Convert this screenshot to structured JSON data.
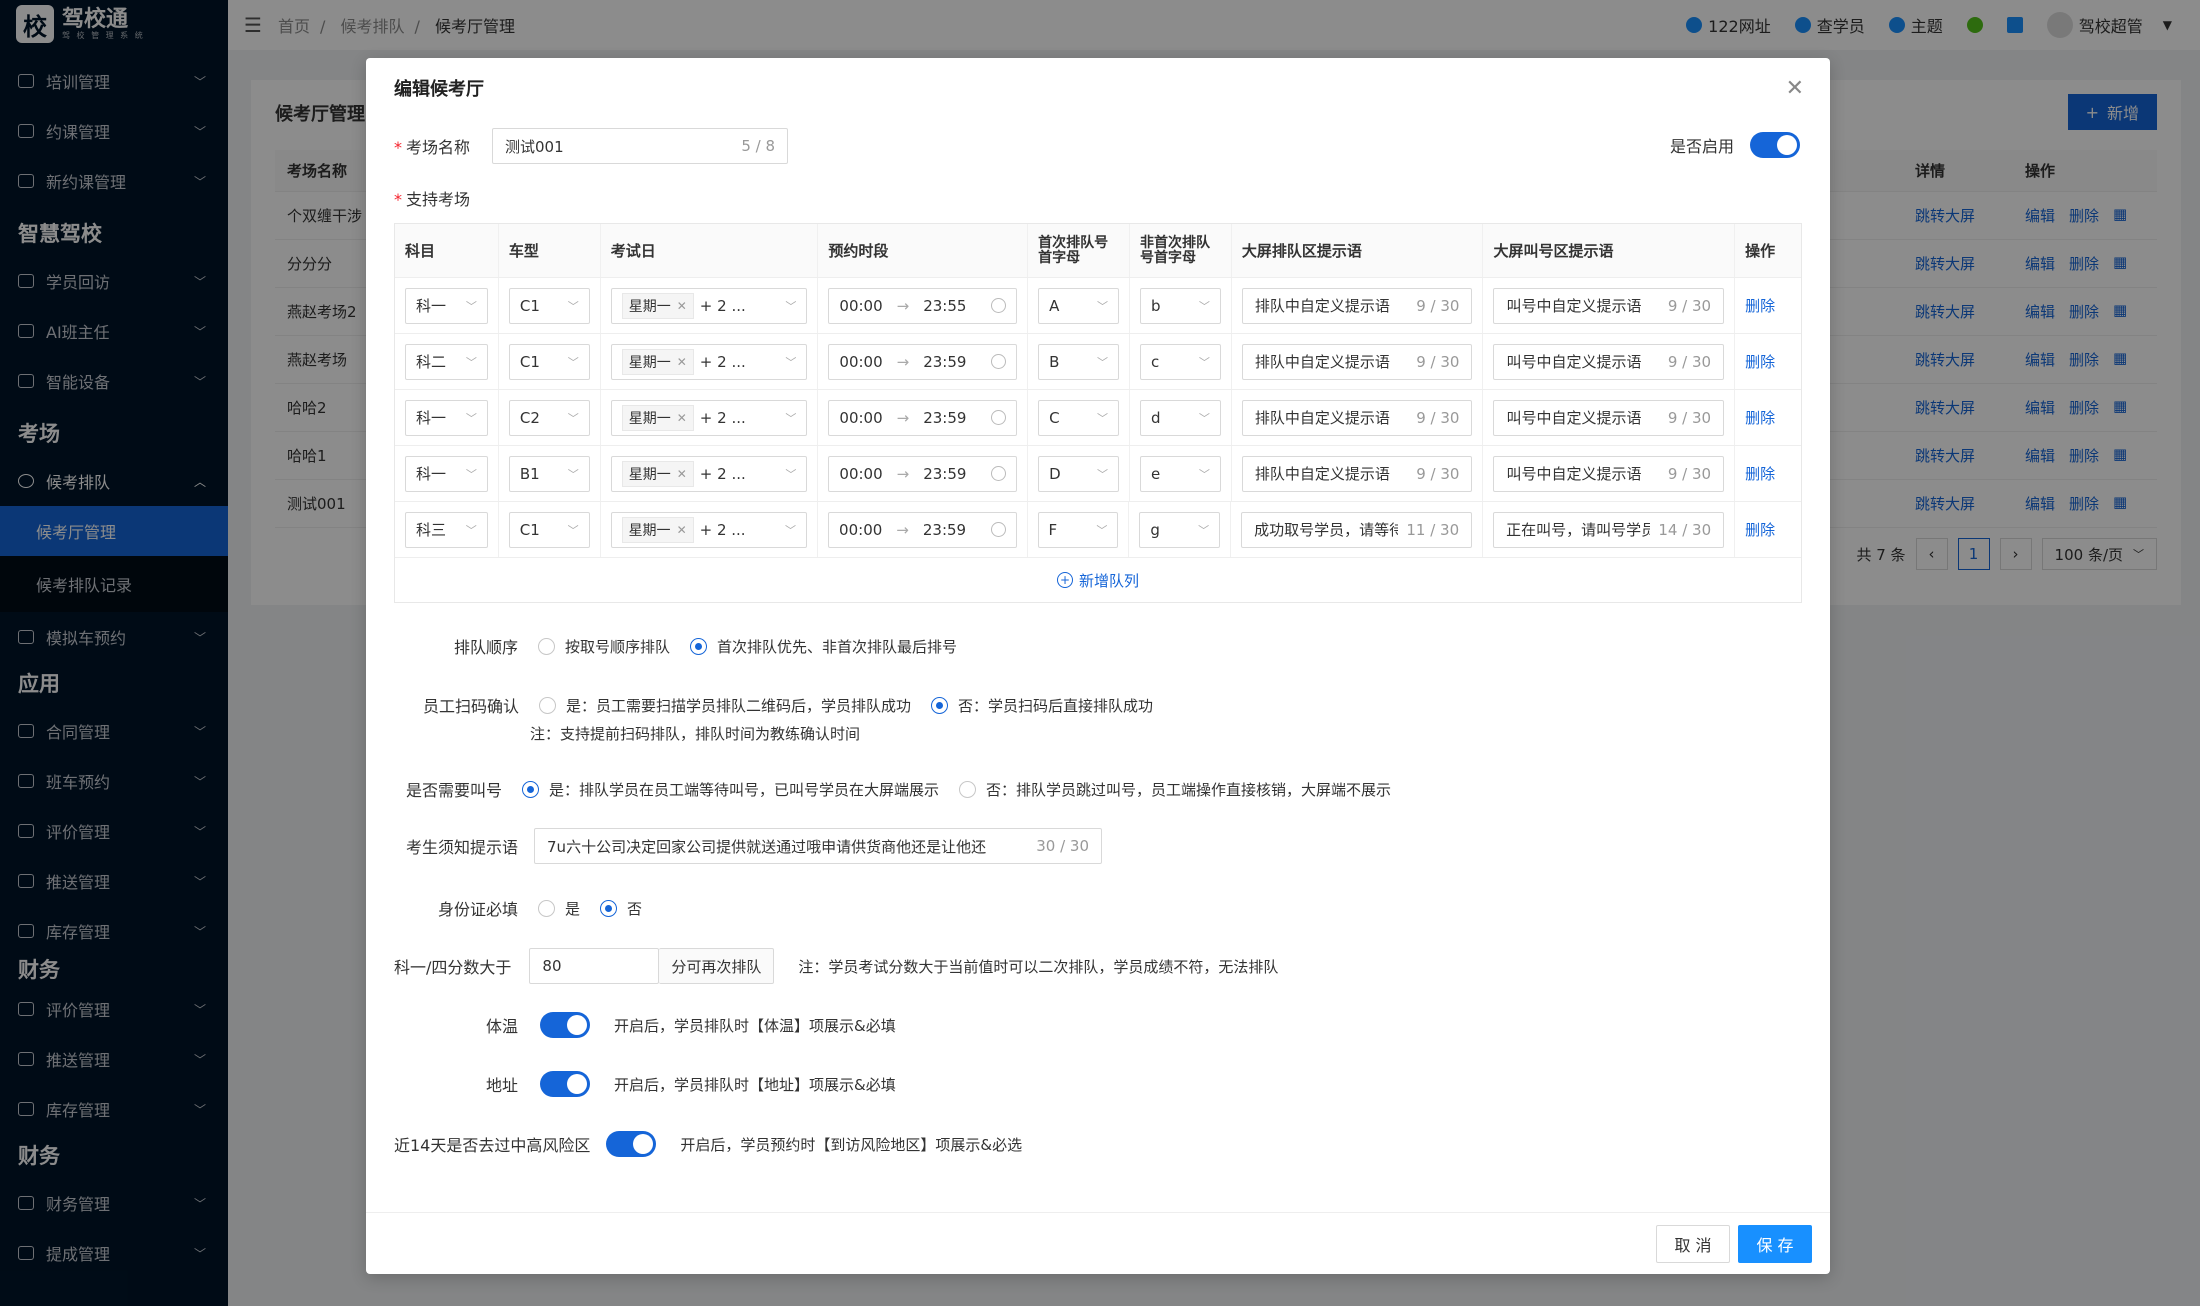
{
  "sidebar": {
    "logo_text": "驾校通",
    "logo_sub": "驾 校 管 理 系 统",
    "logo_mark": "校",
    "items_top": [
      {
        "label": "培训管理"
      },
      {
        "label": "约课管理"
      },
      {
        "label": "新约课管理"
      }
    ],
    "group_smart": "智慧驾校",
    "items_smart": [
      {
        "label": "学员回访"
      },
      {
        "label": "AI班主任"
      },
      {
        "label": "智能设备"
      }
    ],
    "group_exam": "考场",
    "exam_parent": "候考排队",
    "exam_sub": [
      {
        "label": "候考厅管理"
      },
      {
        "label": "候考排队记录"
      }
    ],
    "item_sim": "模拟车预约",
    "group_app": "应用",
    "items_app": [
      {
        "label": "合同管理"
      },
      {
        "label": "班车预约"
      },
      {
        "label": "评价管理"
      },
      {
        "label": "推送管理"
      },
      {
        "label": "库存管理"
      }
    ],
    "group_finance_partial": "财务",
    "items_app2": [
      {
        "label": "评价管理"
      },
      {
        "label": "推送管理"
      },
      {
        "label": "库存管理"
      }
    ],
    "group_finance": "财务",
    "items_finance": [
      {
        "label": "财务管理"
      },
      {
        "label": "提成管理"
      }
    ]
  },
  "header": {
    "breadcrumb": [
      "首页",
      "候考排队",
      "候考厅管理"
    ],
    "links": [
      {
        "label": "122网址"
      },
      {
        "label": "查学员"
      },
      {
        "label": "主题"
      }
    ],
    "user": "驾校超管"
  },
  "background": {
    "title": "候考厅管理",
    "add_label": "新增",
    "columns": {
      "name": "考场名称",
      "detail": "详情",
      "ops": "操作"
    },
    "rows": [
      {
        "name": "个双缠干涉"
      },
      {
        "name": "分分分"
      },
      {
        "name": "燕赵考场2"
      },
      {
        "name": "燕赵考场"
      },
      {
        "name": "哈哈2"
      },
      {
        "name": "哈哈1"
      },
      {
        "name": "测试001"
      }
    ],
    "detail_link": "跳转大屏",
    "op_edit": "编辑",
    "op_delete": "删除",
    "total": "共 7 条",
    "page": "1",
    "page_size": "100 条/页"
  },
  "modal": {
    "title": "编辑候考厅",
    "name_label": "考场名称",
    "name_value": "测试001",
    "name_count": "5 / 8",
    "enable_label": "是否启用",
    "support_label": "支持考场",
    "table_headers": [
      "科目",
      "车型",
      "考试日",
      "预约时段",
      "首次排队号首字母",
      "非首次排队号首字母",
      "大屏排队区提示语",
      "大屏叫号区提示语",
      "操作"
    ],
    "rows": [
      {
        "subject": "科一",
        "car": "C1",
        "day": "星期一",
        "more": "+ 2 ...",
        "start": "00:00",
        "end": "23:55",
        "first": "A",
        "nonfirst": "b",
        "queue_tip": "排队中自定义提示语",
        "queue_cnt": "9 / 30",
        "call_tip": "叫号中自定义提示语",
        "call_cnt": "9 / 30"
      },
      {
        "subject": "科二",
        "car": "C1",
        "day": "星期一",
        "more": "+ 2 ...",
        "start": "00:00",
        "end": "23:59",
        "first": "B",
        "nonfirst": "c",
        "queue_tip": "排队中自定义提示语",
        "queue_cnt": "9 / 30",
        "call_tip": "叫号中自定义提示语",
        "call_cnt": "9 / 30"
      },
      {
        "subject": "科一",
        "car": "C2",
        "day": "星期一",
        "more": "+ 2 ...",
        "start": "00:00",
        "end": "23:59",
        "first": "C",
        "nonfirst": "d",
        "queue_tip": "排队中自定义提示语",
        "queue_cnt": "9 / 30",
        "call_tip": "叫号中自定义提示语",
        "call_cnt": "9 / 30"
      },
      {
        "subject": "科一",
        "car": "B1",
        "day": "星期一",
        "more": "+ 2 ...",
        "start": "00:00",
        "end": "23:59",
        "first": "D",
        "nonfirst": "e",
        "queue_tip": "排队中自定义提示语",
        "queue_cnt": "9 / 30",
        "call_tip": "叫号中自定义提示语",
        "call_cnt": "9 / 30"
      },
      {
        "subject": "科三",
        "car": "C1",
        "day": "星期一",
        "more": "+ 2 ...",
        "start": "00:00",
        "end": "23:59",
        "first": "F",
        "nonfirst": "g",
        "queue_tip": "成功取号学员，请等待",
        "queue_cnt": "11 / 30",
        "call_tip": "正在叫号，请叫号学员",
        "call_cnt": "14 / 30"
      }
    ],
    "row_delete": "删除",
    "add_queue": "新增队列",
    "order_label": "排队顺序",
    "order_opt1": "按取号顺序排队",
    "order_opt2": "首次排队优先、非首次排队最后排号",
    "scan_label": "员工扫码确认",
    "scan_opt1": "是：员工需要扫描学员排队二维码后，学员排队成功",
    "scan_opt2": "否：学员扫码后直接排队成功",
    "scan_note": "注：支持提前扫码排队，排队时间为教练确认时间",
    "call_label": "是否需要叫号",
    "call_opt1": "是：排队学员在员工端等待叫号，已叫号学员在大屏端展示",
    "call_opt2": "否：排队学员跳过叫号，员工端操作直接核销，大屏端不展示",
    "notice_label": "考生须知提示语",
    "notice_value": "7u六十公司决定回家公司提供就送通过哦申请供货商他还是让他还",
    "notice_count": "30 / 30",
    "id_label": "身份证必填",
    "id_yes": "是",
    "id_no": "否",
    "score_label": "科一/四分数大于",
    "score_value": "80",
    "score_suffix": "分可再次排队",
    "score_note": "注：学员考试分数大于当前值时可以二次排队，学员成绩不符，无法排队",
    "temp_label": "体温",
    "temp_note": "开启后，学员排队时【体温】项展示&必填",
    "addr_label": "地址",
    "addr_note": "开启后，学员排队时【地址】项展示&必填",
    "risk_label": "近14天是否去过中高风险区",
    "risk_note": "开启后，学员预约时【到访风险地区】项展示&必选",
    "cancel": "取 消",
    "save": "保 存"
  }
}
